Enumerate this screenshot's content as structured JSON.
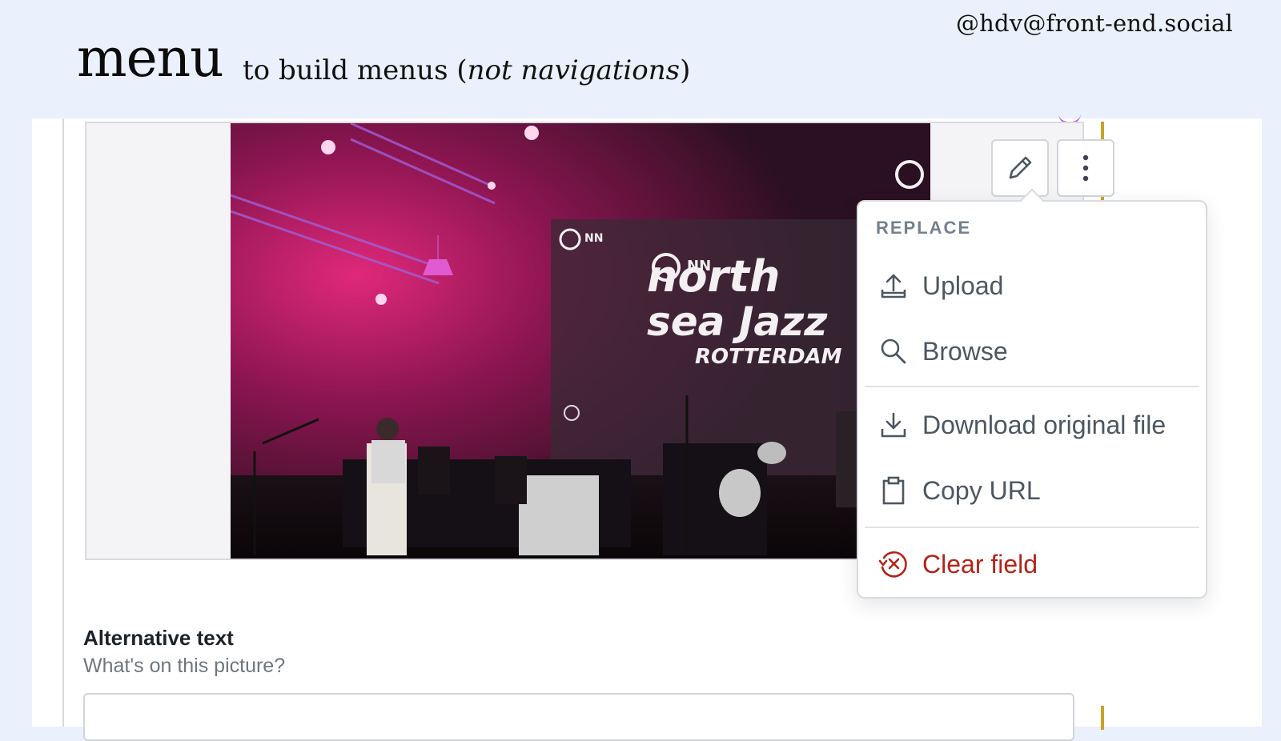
{
  "slide": {
    "handle": "@hdv@front-end.social",
    "title": "menu",
    "subtitle_prefix": "to build menus (",
    "subtitle_em": "not navigations",
    "subtitle_suffix": ")"
  },
  "photo_text": {
    "brand_small": "NN",
    "line1": "north",
    "line2": "sea Jazz",
    "line3": "ROTTERDAM"
  },
  "toolbar": {
    "edit_icon": "pencil-icon",
    "more_icon": "vertical-dots-icon"
  },
  "menu": {
    "heading": "REPLACE",
    "items": [
      {
        "label": "Upload",
        "icon": "upload-icon"
      },
      {
        "label": "Browse",
        "icon": "search-icon"
      },
      {
        "label": "Download original file",
        "icon": "download-icon"
      },
      {
        "label": "Copy URL",
        "icon": "clipboard-icon"
      },
      {
        "label": "Clear field",
        "icon": "clear-circle-icon",
        "color": "#b42318"
      }
    ]
  },
  "alt_text": {
    "label": "Alternative text",
    "hint": "What's on this picture?"
  },
  "colors": {
    "background": "#eaf1fc",
    "danger": "#b42318",
    "accent_gold": "#c9a227",
    "muted": "#4d5661"
  }
}
